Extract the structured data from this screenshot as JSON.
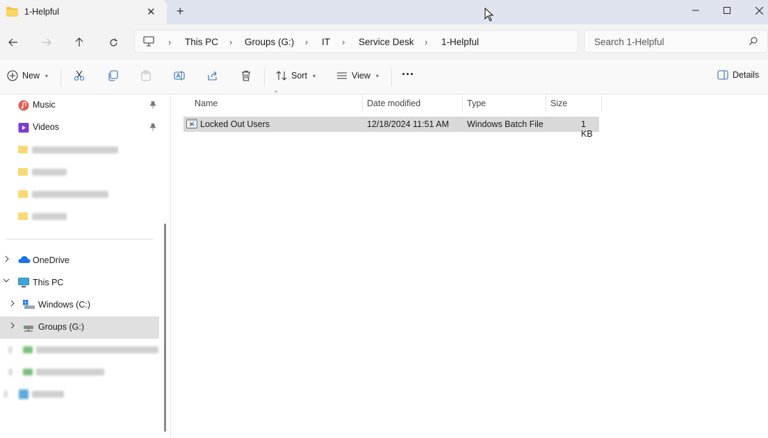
{
  "tab": {
    "title": "1-Helpful",
    "close": "✕",
    "new_tab": "+"
  },
  "window_controls": {
    "minimize": "—",
    "maximize": "☐",
    "close": "✕"
  },
  "breadcrumb": [
    "This PC",
    "Groups (G:)",
    "IT",
    "Service Desk",
    "1-Helpful"
  ],
  "search": {
    "placeholder": "Search 1-Helpful"
  },
  "toolbar": {
    "new_label": "New",
    "sort_label": "Sort",
    "view_label": "View",
    "more_label": "···",
    "details_label": "Details"
  },
  "sidebar": {
    "quick_access": [
      {
        "label": "Music",
        "icon": "music-icon",
        "pinned": true
      },
      {
        "label": "Videos",
        "icon": "videos-icon",
        "pinned": true
      }
    ],
    "tree": [
      {
        "label": "OneDrive",
        "icon": "onedrive-icon"
      },
      {
        "label": "This PC",
        "icon": "pc-icon",
        "expanded": true
      },
      {
        "label": "Windows (C:)",
        "icon": "drive-icon"
      },
      {
        "label": "Groups (G:)",
        "icon": "network-drive-icon",
        "selected": true
      }
    ]
  },
  "columns": {
    "name": "Name",
    "date": "Date modified",
    "type": "Type",
    "size": "Size"
  },
  "files": [
    {
      "name": "Locked Out Users",
      "date": "12/18/2024 11:51 AM",
      "type": "Windows Batch File",
      "size": "1 KB",
      "icon": "batch-file-icon",
      "selected": true
    }
  ]
}
